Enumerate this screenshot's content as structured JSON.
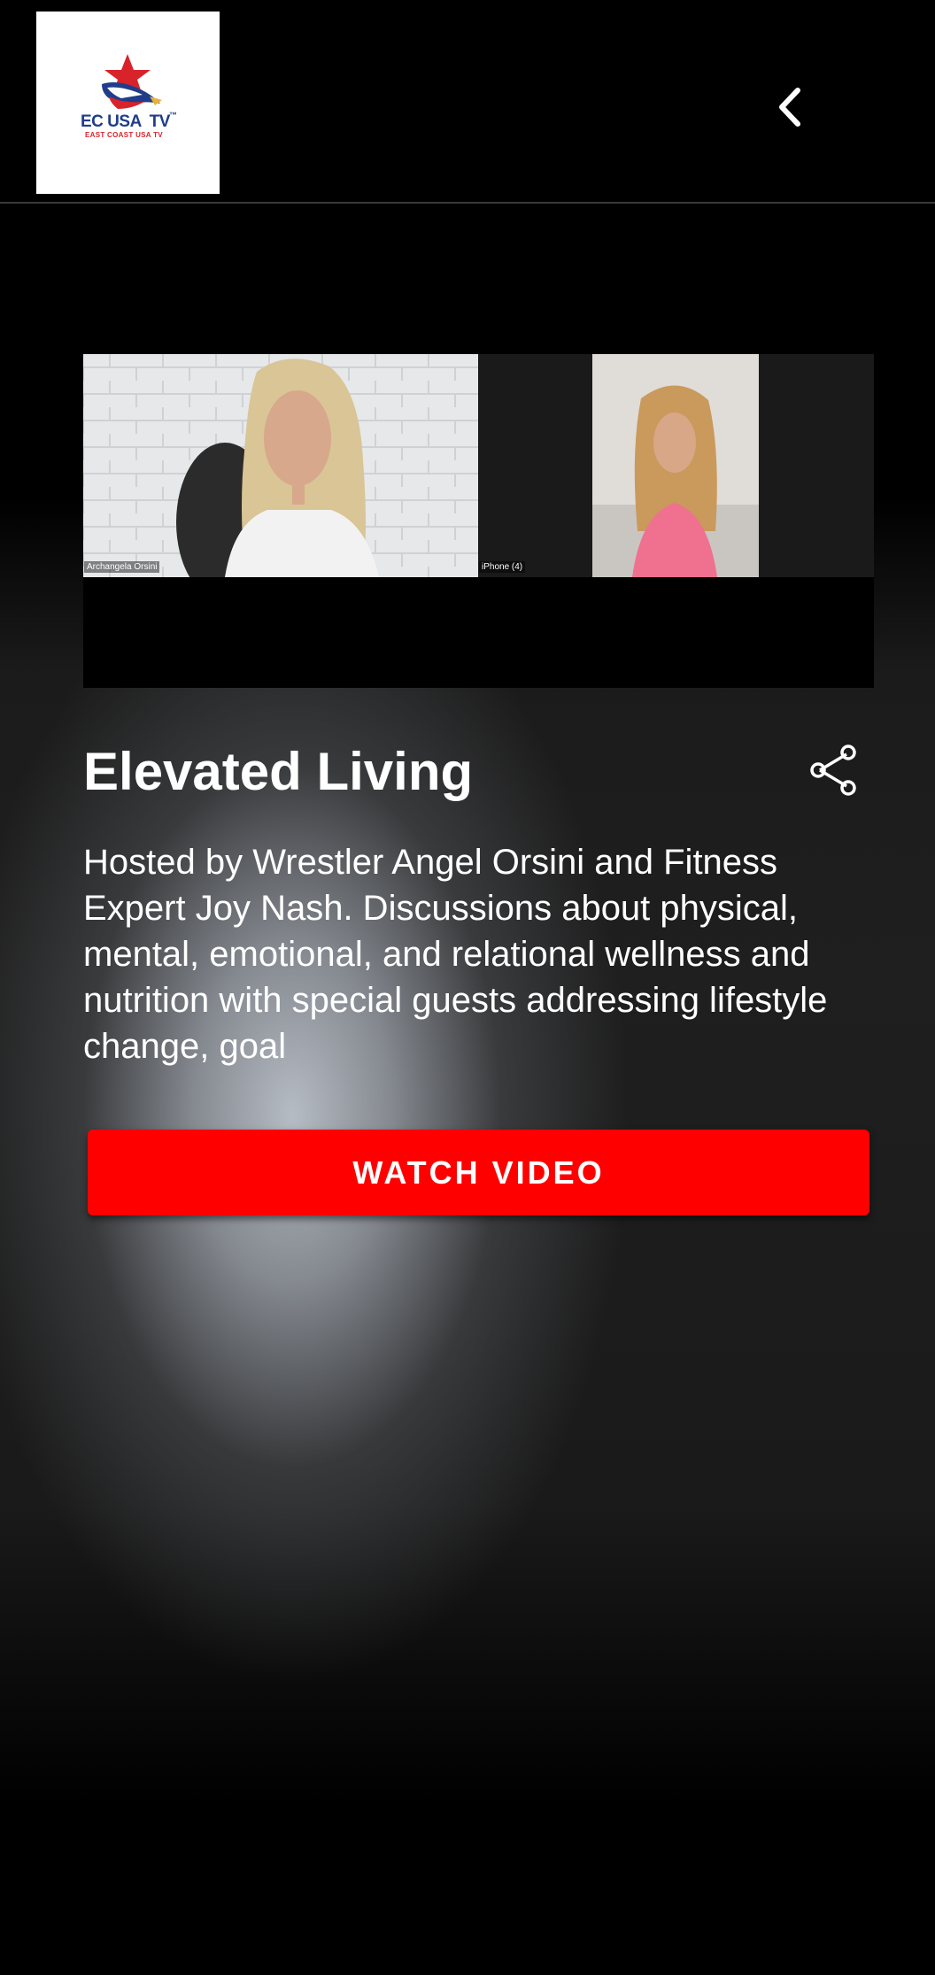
{
  "header": {
    "logo": {
      "main_text": "EC USA  TV",
      "trademark": "™",
      "sub_text": "EAST COAST USA TV"
    },
    "back_icon": "chevron-left-icon"
  },
  "video_thumbnail": {
    "participant_left_name": "Archangela Orsini",
    "participant_right_name": "iPhone (4)"
  },
  "show": {
    "title": "Elevated Living",
    "share_icon": "share-icon",
    "description": "Hosted by Wrestler Angel Orsini and Fitness Expert Joy Nash. Discussions about physical, mental, emotional, and relational wellness and nutrition with special guests addressing lifestyle change, goal"
  },
  "actions": {
    "watch_label": "WATCH VIDEO"
  },
  "colors": {
    "accent": "#ff0000",
    "background": "#000000",
    "text": "#ffffff"
  }
}
